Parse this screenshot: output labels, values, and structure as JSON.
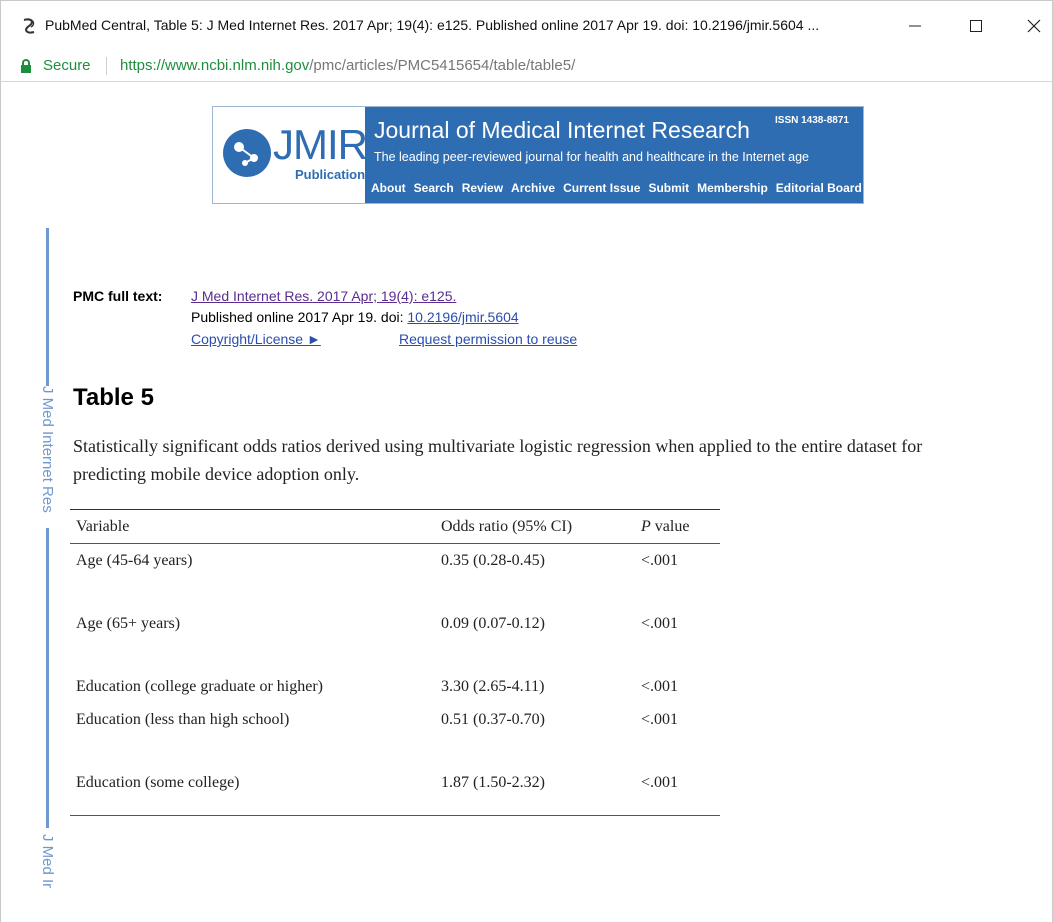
{
  "window": {
    "title": "PubMed Central, Table 5: J Med Internet Res. 2017 Apr; 19(4): e125. Published online 2017 Apr 19. doi:  10.2196/jmir.5604 ...",
    "controls": {
      "minimize": "—",
      "maximize": "☐",
      "close": "✕"
    }
  },
  "address": {
    "secure_label": "Secure",
    "url_host": "https://www.ncbi.nlm.nih.gov",
    "url_path": "/pmc/articles/PMC5415654/table/table5/"
  },
  "banner": {
    "logo_text": "JMIR",
    "logo_sub": "Publications",
    "journal_title": "Journal of Medical Internet Research",
    "issn": "ISSN 1438-8871",
    "tagline": "The leading peer-reviewed journal for health and healthcare in the Internet age",
    "nav": [
      "About",
      "Search",
      "Review",
      "Archive",
      "Current Issue",
      "Submit",
      "Membership",
      "Editorial Board"
    ],
    "colors": {
      "brand_blue": "#2f6db3"
    }
  },
  "sidebar": {
    "label_top": "J Med Internet Res",
    "label_bottom": "J Med Ir"
  },
  "pmc": {
    "label": "PMC full text:",
    "citation_link": "J Med Internet Res. 2017 Apr; 19(4): e125.",
    "published_text": "Published online 2017 Apr 19. doi: ",
    "doi_link": "10.2196/jmir.5604",
    "copyright_link": "Copyright/License ►",
    "permission_link": "Request permission to reuse"
  },
  "table": {
    "title": "Table 5",
    "caption": "Statistically significant odds ratios derived using multivariate logistic regression when applied to the entire dataset for predicting mobile device adoption only.",
    "headers": {
      "variable": "Variable",
      "odds": "Odds ratio (95% CI)",
      "p_italic": "P",
      "p_rest": " value"
    },
    "rows": [
      {
        "variable": "Age (45-64 years)",
        "odds": "0.35 (0.28-0.45)",
        "p": "<.001"
      },
      {
        "variable": "Age (65+ years)",
        "odds": "0.09 (0.07-0.12)",
        "p": "<.001"
      },
      {
        "variable": "Education (college graduate or higher)",
        "odds": "3.30 (2.65-4.11)",
        "p": "<.001"
      },
      {
        "variable": "Education (less than high school)",
        "odds": "0.51 (0.37-0.70)",
        "p": "<.001"
      },
      {
        "variable": "Education (some college)",
        "odds": "1.87 (1.50-2.32)",
        "p": "<.001"
      }
    ]
  }
}
